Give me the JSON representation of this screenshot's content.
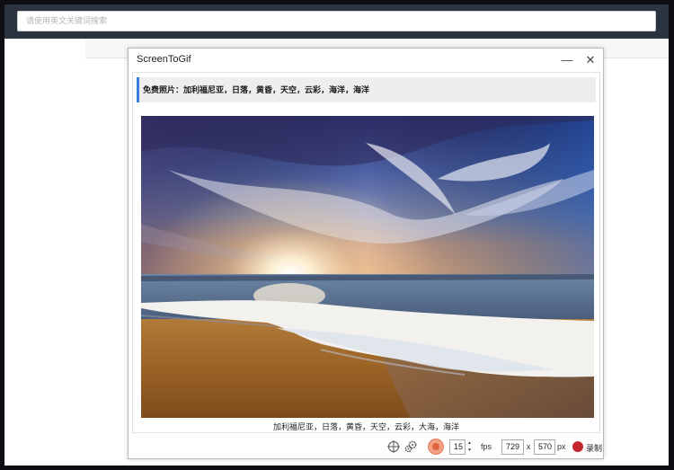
{
  "browser": {
    "search_placeholder": "请使用英文关键词搜索"
  },
  "window": {
    "title": "ScreenToGif",
    "minimize_glyph": "—",
    "close_glyph": "✕"
  },
  "content": {
    "heading": "免费照片：加利福尼亚，日落，黄昏，天空，云彩，海洋，海洋",
    "photo_caption": "加利福尼亚，日落，黄昏，天空，云彩，大海，海洋"
  },
  "statusbar": {
    "fps_value": "15",
    "fps_unit": "fps",
    "width_value": "729",
    "times_sign": "x",
    "height_value": "570",
    "px_unit": "px",
    "record_label": "录制",
    "spin_up": "▲",
    "spin_down": "▼"
  },
  "icons": {
    "crosshair": "crosshair-icon",
    "settings": "gears-icon",
    "record_toggle": "record-toggle-icon",
    "record": "record-dot-icon"
  },
  "colors": {
    "topbar": "#2b3341",
    "heading_accent": "#3a7dd8",
    "record_red": "#c4262e",
    "record_toggle": "#f2a184"
  }
}
